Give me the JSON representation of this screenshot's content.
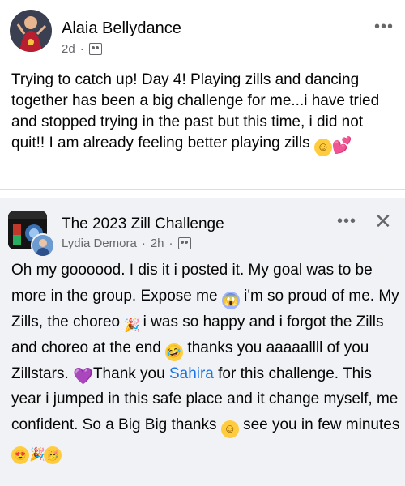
{
  "post1": {
    "author": "Alaia Bellydance",
    "time": "2d",
    "more_label": "•••",
    "text": "Trying to catch up! Day 4! Playing zills and dancing together has been a big challenge for me...i have tried and stopped trying in the past but this time, i did not quit!! I am already feeling better playing zills"
  },
  "post2": {
    "group_name": "The 2023 Zill Challenge",
    "author": "Lydia Demora",
    "time": "2h",
    "more_label": "•••",
    "close_label": "✕",
    "text": {
      "p1": "Oh my goooood. I dis it i posted it. My goal was to be more in the group. Expose me",
      "p2": " i'm so proud of me. My Zills, the choreo",
      "p3": " i was so happy and i forgot the  Zills and choreo at the end",
      "p4": " thanks you aaaaallll of you Zillstars.",
      "p5": " Thank you ",
      "mention": "Sahira",
      "p6": " for this challenge. This year i jumped in this safe place and it change myself, me confident. So a Big Big thanks",
      "p7": " see you in few minutes"
    }
  },
  "emoji": {
    "smile": "☺",
    "heart": "💕",
    "scream": "😱",
    "party": "🎉",
    "rofl": "😂",
    "purple_heart": "💜",
    "heart_eyes": "😍",
    "party_face": "🥳"
  },
  "colors": {
    "link": "#1b74e4",
    "muted": "#65676b",
    "bg2": "#f0f2f5"
  }
}
